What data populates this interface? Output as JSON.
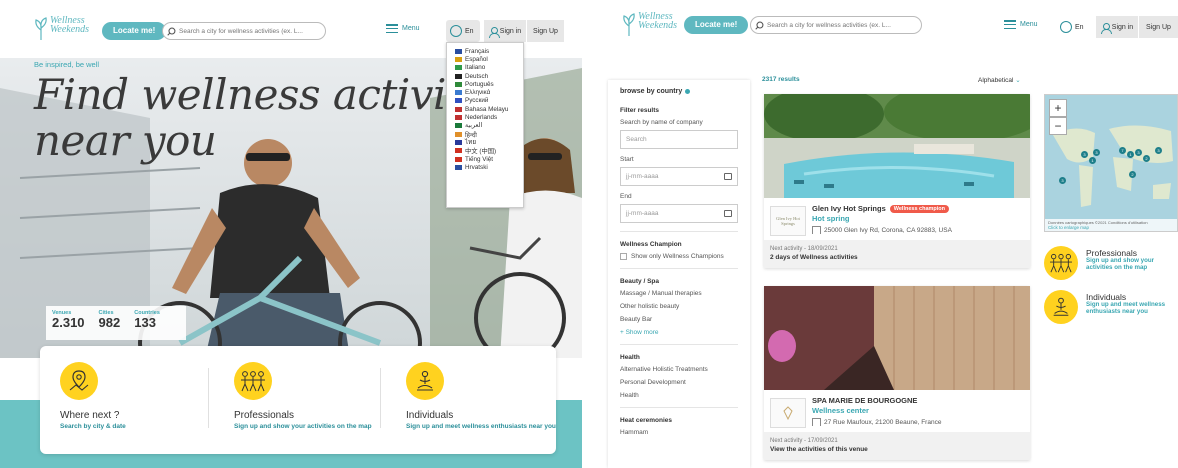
{
  "header": {
    "logo_line1": "Wellness",
    "logo_line2": "Weekends",
    "locate_label": "Locate me!",
    "search_placeholder": "Search a city for wellness activities (ex. L...",
    "menu_label": "Menu",
    "lang_label": "En",
    "signin_label": "Sign in",
    "signup_label": "Sign Up"
  },
  "languages": [
    {
      "label": "Français",
      "color": "#2a4ea0"
    },
    {
      "label": "Español",
      "color": "#d8a010"
    },
    {
      "label": "Italiano",
      "color": "#2f9a4a"
    },
    {
      "label": "Deutsch",
      "color": "#222222"
    },
    {
      "label": "Português",
      "color": "#2f8a3a"
    },
    {
      "label": "Ελληνικά",
      "color": "#3a7ad0"
    },
    {
      "label": "Русский",
      "color": "#3050c0"
    },
    {
      "label": "Bahasa Melayu",
      "color": "#c03030"
    },
    {
      "label": "Nederlands",
      "color": "#c03030"
    },
    {
      "label": "العربية",
      "color": "#1a7a3a"
    },
    {
      "label": "हिन्दी",
      "color": "#e0902a"
    },
    {
      "label": "ไทย",
      "color": "#2a3a9a"
    },
    {
      "label": "中文 (中国)",
      "color": "#d03020"
    },
    {
      "label": "Tiếng Việt",
      "color": "#d03020"
    },
    {
      "label": "Hrvatski",
      "color": "#2a4ea0"
    }
  ],
  "hero": {
    "tagline": "Be inspired, be well",
    "headline_line1": "Find wellness activities",
    "headline_line2": "near you"
  },
  "stats": [
    {
      "label": "Venues",
      "value": "2.310"
    },
    {
      "label": "Cities",
      "value": "982"
    },
    {
      "label": "Countries",
      "value": "133"
    }
  ],
  "features": [
    {
      "title": "Where next ?",
      "subtitle": "Search by city & date",
      "icon": "map-pin-icon"
    },
    {
      "title": "Professionals",
      "subtitle": "Sign up and show your activities on the map",
      "icon": "people-icon"
    },
    {
      "title": "Individuals",
      "subtitle": "Sign up and meet wellness enthusiasts near you",
      "icon": "meditation-icon"
    }
  ],
  "sidebar": {
    "browse_label": "browse by country",
    "filter_title": "Filter results",
    "company_label": "Search by name of company",
    "company_placeholder": "Search",
    "start_label": "Start",
    "start_placeholder": "jj-mm-aaaa",
    "end_label": "End",
    "end_placeholder": "jj-mm-aaaa",
    "champion_title": "Wellness Champion",
    "champion_checkbox": "Show only Wellness Champions",
    "beauty_title": "Beauty / Spa",
    "beauty_items": [
      "Massage / Manual therapies",
      "Other holistic beauty",
      "Beauty Bar"
    ],
    "show_more": "+ Show more",
    "health_title": "Health",
    "health_items": [
      "Alternative Holistic Treatments",
      "Personal Development",
      "Health"
    ],
    "heat_title": "Heat ceremonies",
    "heat_items": [
      "Hammam"
    ]
  },
  "results": {
    "count": "2317 results",
    "sort_label": "Alphabetical"
  },
  "venues": [
    {
      "logo_text": "Glen Ivy Hot Springs",
      "name": "Glen Ivy Hot Springs",
      "badge": "Wellness champion",
      "category": "Hot spring",
      "address": "25000 Glen Ivy Rd, Corona, CA 92883, USA",
      "next_activity": "Next activity - 18/09/2021",
      "activities": "2 days of Wellness activities"
    },
    {
      "logo_text": "",
      "name": "SPA MARIE DE BOURGOGNE",
      "badge": "",
      "category": "Wellness center",
      "address": "27 Rue Maufoux, 21200 Beaune, France",
      "next_activity": "Next activity - 17/09/2021",
      "activities": "View the activities of this venue"
    }
  ],
  "map": {
    "zoom_in": "+",
    "zoom_out": "−",
    "attribution": "Données cartographiques ©2021  Conditions d'utilisation",
    "enlarge": "Click to enlarge map",
    "pins": [
      "3",
      "3",
      "1",
      "7",
      "1",
      "3",
      "2",
      "3",
      "2",
      "3"
    ]
  },
  "promos": [
    {
      "title": "Professionals",
      "subtitle": "Sign up and show your activities on the map"
    },
    {
      "title": "Individuals",
      "subtitle": "Sign up and meet wellness enthusiasts near you"
    }
  ],
  "colors": {
    "teal": "#5fb8c0",
    "teal_dark": "#2b8f9a",
    "yellow": "#ffd21f",
    "badge_red": "#f05a4a"
  }
}
